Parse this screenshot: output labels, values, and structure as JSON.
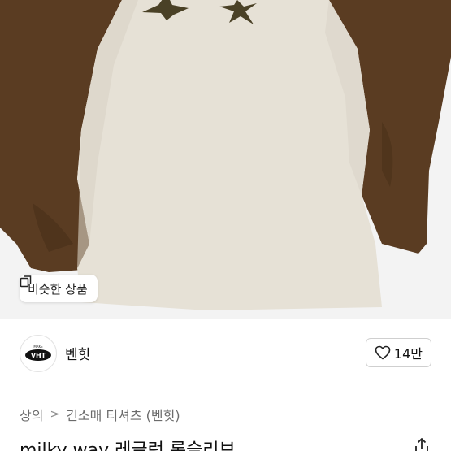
{
  "similar_button": {
    "label": "비슷한 상품"
  },
  "shop": {
    "name": "벤힛",
    "logo_text": "VHT",
    "logo_small_text": "MAKE"
  },
  "like": {
    "count": "14만"
  },
  "breadcrumb": [
    {
      "label": "상의"
    },
    {
      "label": "긴소매 티셔츠 (벤힛)"
    }
  ],
  "breadcrumb_separator": ">",
  "product": {
    "title": "milky way 레글런 롱슬리브"
  },
  "colors": {
    "sleeve_brown": "#5a3c22",
    "body_cream": "#e6e1d6",
    "star_olive": "#4a4126"
  }
}
